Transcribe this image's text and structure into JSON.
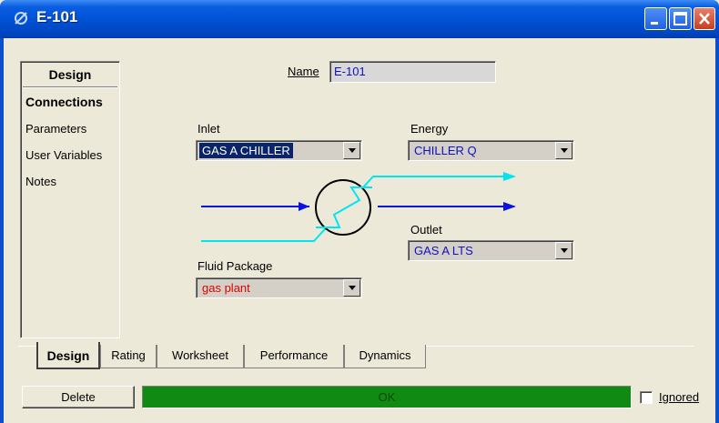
{
  "window": {
    "title": "E-101"
  },
  "nav": {
    "header": "Design",
    "items": [
      {
        "label": "Connections",
        "active": true
      },
      {
        "label": "Parameters",
        "active": false
      },
      {
        "label": "User Variables",
        "active": false
      },
      {
        "label": "Notes",
        "active": false
      }
    ]
  },
  "form": {
    "name_label": "Name",
    "name_value": "E-101",
    "inlet_label": "Inlet",
    "inlet_value": "GAS A  CHILLER",
    "energy_label": "Energy",
    "energy_value": "CHILLER Q",
    "outlet_label": "Outlet",
    "outlet_value": "GAS A LTS",
    "fluid_package_label": "Fluid Package",
    "fluid_package_value": "gas plant"
  },
  "tabs": [
    {
      "label": "Design",
      "active": true
    },
    {
      "label": "Rating",
      "active": false
    },
    {
      "label": "Worksheet",
      "active": false
    },
    {
      "label": "Performance",
      "active": false
    },
    {
      "label": "Dynamics",
      "active": false
    }
  ],
  "footer": {
    "delete_label": "Delete",
    "status_text": "OK",
    "ignored_label": "Ignored",
    "ignored_checked": false
  },
  "colors": {
    "title_bar": "#0052d6",
    "status_ok": "#118a14",
    "stream_process": "#0a14dc",
    "stream_energy": "#00e5f0",
    "selected_highlight": "#0a246a",
    "fluid_package_text": "#e00000"
  },
  "icons": [
    "window-app-icon",
    "minimize-icon",
    "maximize-icon",
    "close-icon",
    "dropdown-arrow-icon",
    "heat-exchanger-icon"
  ]
}
